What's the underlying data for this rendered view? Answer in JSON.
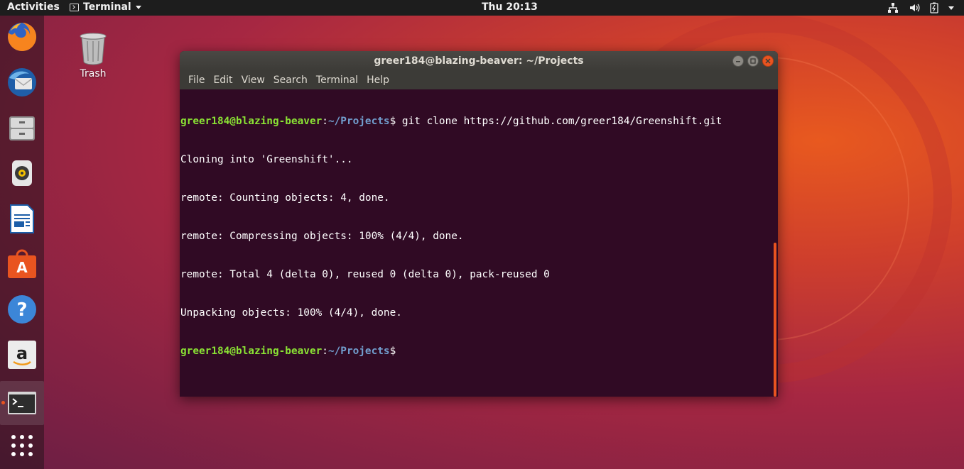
{
  "topbar": {
    "activities": "Activities",
    "app_menu_label": "Terminal",
    "clock": "Thu 20:13"
  },
  "dock": {
    "items": [
      {
        "name": "firefox-icon"
      },
      {
        "name": "thunderbird-icon"
      },
      {
        "name": "files-icon"
      },
      {
        "name": "rhythmbox-icon"
      },
      {
        "name": "libreoffice-writer-icon"
      },
      {
        "name": "ubuntu-software-icon"
      },
      {
        "name": "help-icon"
      },
      {
        "name": "amazon-icon"
      },
      {
        "name": "terminal-icon"
      },
      {
        "name": "show-applications-icon"
      }
    ]
  },
  "desktop": {
    "trash_label": "Trash"
  },
  "window": {
    "title": "greer184@blazing-beaver: ~/Projects",
    "menu": [
      "File",
      "Edit",
      "View",
      "Search",
      "Terminal",
      "Help"
    ]
  },
  "terminal": {
    "prompt_user": "greer184@blazing-beaver",
    "prompt_sep": ":",
    "prompt_path": "~/Projects",
    "prompt_end": "$",
    "command": " git clone https://github.com/greer184/Greenshift.git",
    "output": [
      "Cloning into 'Greenshift'...",
      "remote: Counting objects: 4, done.",
      "remote: Compressing objects: 100% (4/4), done.",
      "remote: Total 4 (delta 0), reused 0 (delta 0), pack-reused 0",
      "Unpacking objects: 100% (4/4), done."
    ]
  },
  "colors": {
    "terminal_bg": "#300a24",
    "prompt_user": "#8ae234",
    "prompt_path": "#729fcf",
    "accent": "#e95420"
  }
}
